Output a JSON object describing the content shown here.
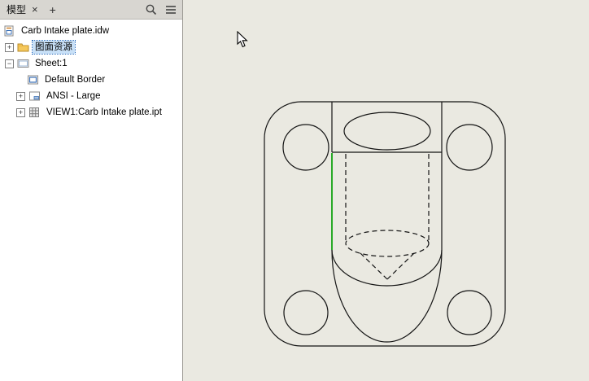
{
  "panel": {
    "tab_bar": {
      "tab_label": "模型",
      "close_label": "×",
      "add_label": "+"
    },
    "tree": [
      {
        "label": "Carb Intake plate.idw",
        "icon": "idw-document-icon"
      },
      {
        "expander": "+",
        "label": "图面资源",
        "icon": "folder-icon",
        "selected": true
      },
      {
        "expander": "−",
        "label": "Sheet:1",
        "icon": "sheet-icon"
      },
      {
        "label": "Default Border",
        "icon": "border-icon"
      },
      {
        "expander": "+",
        "label": "ANSI - Large",
        "icon": "title-block-icon"
      },
      {
        "expander": "+",
        "label": "VIEW1:Carb Intake plate.ipt",
        "icon": "base-view-icon"
      }
    ]
  },
  "canvas": {
    "background_color": "#eae9e1",
    "line_color": "#141414",
    "selected_edge_color": "#12a312"
  }
}
